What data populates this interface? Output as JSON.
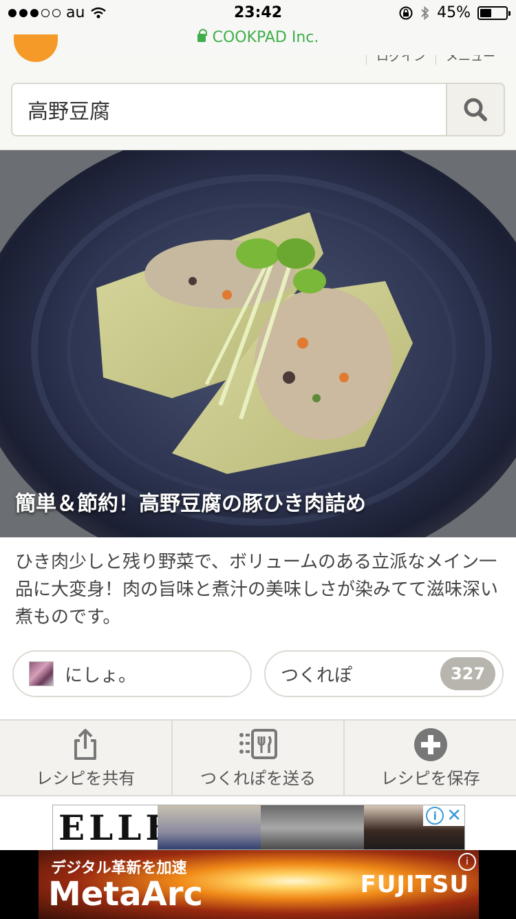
{
  "status_bar": {
    "carrier": "au",
    "time": "23:42",
    "battery": "45%",
    "battery_level": 0.45,
    "url": "COOKPAD Inc."
  },
  "header": {
    "links": [
      "ログイン",
      "メニュー"
    ],
    "search_value": "高野豆腐"
  },
  "recipe": {
    "title": "簡単＆節約！高野豆腐の豚ひき肉詰め",
    "description": "ひき肉少しと残り野菜で、ボリュームのある立派なメイン一品に大変身！肉の旨味と煮汁の美味しさが染みてて滋味深い煮ものです。",
    "author": "にしょ。",
    "tsukurepo_label": "つくれぽ",
    "tsukurepo_count": "327"
  },
  "actions": [
    {
      "label": "レシピを共有",
      "icon": "share-icon"
    },
    {
      "label": "つくれぽを送る",
      "icon": "send-tsukurepo-icon"
    },
    {
      "label": "レシピを保存",
      "icon": "add-icon"
    }
  ],
  "ads": {
    "elle_logo": "ELLE",
    "banner_sub": "デジタル革新を加速",
    "banner_main": "MetaArc",
    "banner_brand": "FUJITSU"
  }
}
